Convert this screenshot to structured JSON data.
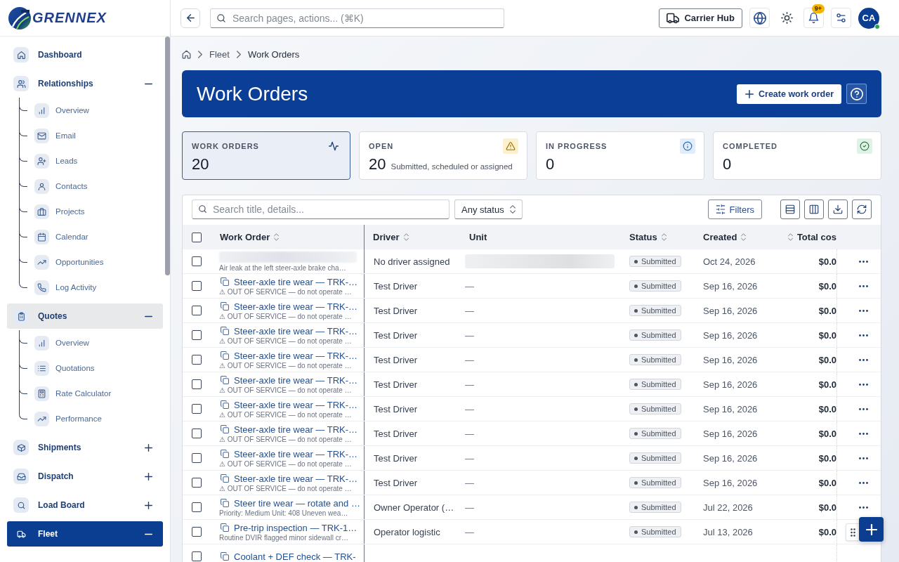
{
  "sidebar": {
    "brand": "GRENNEX",
    "items": [
      {
        "label": "Dashboard",
        "selected": false,
        "highlighted": false
      },
      {
        "label": "Relationships",
        "selected": false,
        "highlighted": false,
        "expanded": true,
        "children": [
          {
            "label": "Overview",
            "selected": false
          },
          {
            "label": "Email",
            "selected": false
          },
          {
            "label": "Leads",
            "selected": false
          },
          {
            "label": "Contacts",
            "selected": false
          },
          {
            "label": "Projects",
            "selected": false
          },
          {
            "label": "Calendar",
            "selected": false
          },
          {
            "label": "Opportunities",
            "selected": false
          },
          {
            "label": "Log Activity",
            "selected": false
          }
        ]
      },
      {
        "label": "Quotes",
        "selected": false,
        "highlighted": true,
        "expanded": true,
        "children": [
          {
            "label": "Overview",
            "selected": false
          },
          {
            "label": "Quotations",
            "selected": false
          },
          {
            "label": "Rate Calculator",
            "selected": false
          },
          {
            "label": "Performance",
            "selected": false
          }
        ]
      },
      {
        "label": "Shipments",
        "selected": false,
        "highlighted": false,
        "expanded": false
      },
      {
        "label": "Dispatch",
        "selected": false,
        "highlighted": false,
        "expanded": false
      },
      {
        "label": "Load Board",
        "selected": false,
        "highlighted": false,
        "expanded": false
      },
      {
        "label": "Fleet",
        "selected": true,
        "highlighted": false,
        "expanded": true
      }
    ]
  },
  "top_bar": {
    "search": {
      "placeholder": "Search pages, actions... (⌘K)"
    },
    "hub_button": "Carrier Hub",
    "notifications": {
      "badge": "9+"
    },
    "avatar": {
      "initials": "CA",
      "online": true
    }
  },
  "breadcrumb": [
    {
      "label": "Fleet",
      "current": false
    },
    {
      "label": "Work Orders",
      "current": true
    }
  ],
  "page_header": {
    "title": "Work Orders",
    "create_button": "Create work order"
  },
  "stats": [
    {
      "kind": "total",
      "label": "WORK ORDERS",
      "value": "20",
      "selected": true
    },
    {
      "kind": "open",
      "label": "OPEN",
      "value": "20",
      "note": "Submitted, scheduled or assigned",
      "selected": false
    },
    {
      "kind": "in_progress",
      "label": "IN PROGRESS",
      "value": "0",
      "selected": false
    },
    {
      "kind": "completed",
      "label": "COMPLETED",
      "value": "0",
      "selected": false
    }
  ],
  "work_orders": {
    "search": {
      "placeholder": "Search title, details..."
    },
    "status_filter": "Any status",
    "filters_button": "Filters",
    "all_selected": false,
    "columns": [
      {
        "kind": "text",
        "label": "Work Order",
        "sortable": true
      },
      {
        "kind": "text",
        "label": "Driver",
        "sortable": true
      },
      {
        "kind": "text",
        "label": "Unit",
        "sortable": false
      },
      {
        "kind": "text",
        "label": "Status",
        "sortable": true
      },
      {
        "kind": "text",
        "label": "Created",
        "sortable": true
      },
      {
        "kind": "money",
        "label": "Total cos",
        "sortable": true
      }
    ],
    "rows": [
      {
        "selected": false,
        "title_blurred": true,
        "details": "Air leak at the left steer-axle brake cha…",
        "driver": "No driver assigned",
        "unit_blurred": true,
        "status": "Submitted",
        "created": "Oct 24, 2026",
        "total": "$0.0",
        "menu_button": true
      },
      {
        "selected": false,
        "title": "Steer-axle tire wear — TRK-…",
        "details": "⚠ OUT OF SERVICE — do not operate …",
        "driver": "Test Driver",
        "unit": "—",
        "status": "Submitted",
        "created": "Sep 16, 2026",
        "total": "$0.0",
        "menu_button": true
      },
      {
        "selected": false,
        "title": "Steer-axle tire wear — TRK-…",
        "details": "⚠ OUT OF SERVICE — do not operate …",
        "driver": "Test Driver",
        "unit": "—",
        "status": "Submitted",
        "created": "Sep 16, 2026",
        "total": "$0.0",
        "menu_button": true
      },
      {
        "selected": false,
        "title": "Steer-axle tire wear — TRK-…",
        "details": "⚠ OUT OF SERVICE — do not operate …",
        "driver": "Test Driver",
        "unit": "—",
        "status": "Submitted",
        "created": "Sep 16, 2026",
        "total": "$0.0",
        "menu_button": true
      },
      {
        "selected": false,
        "title": "Steer-axle tire wear — TRK-…",
        "details": "⚠ OUT OF SERVICE — do not operate …",
        "driver": "Test Driver",
        "unit": "—",
        "status": "Submitted",
        "created": "Sep 16, 2026",
        "total": "$0.0",
        "menu_button": true
      },
      {
        "selected": false,
        "title": "Steer-axle tire wear — TRK-…",
        "details": "⚠ OUT OF SERVICE — do not operate …",
        "driver": "Test Driver",
        "unit": "—",
        "status": "Submitted",
        "created": "Sep 16, 2026",
        "total": "$0.0",
        "menu_button": true
      },
      {
        "selected": false,
        "title": "Steer-axle tire wear — TRK-…",
        "details": "⚠ OUT OF SERVICE — do not operate …",
        "driver": "Test Driver",
        "unit": "—",
        "status": "Submitted",
        "created": "Sep 16, 2026",
        "total": "$0.0",
        "menu_button": true
      },
      {
        "selected": false,
        "title": "Steer-axle tire wear — TRK-…",
        "details": "⚠ OUT OF SERVICE — do not operate …",
        "driver": "Test Driver",
        "unit": "—",
        "status": "Submitted",
        "created": "Sep 16, 2026",
        "total": "$0.0",
        "menu_button": true
      },
      {
        "selected": false,
        "title": "Steer-axle tire wear — TRK-…",
        "details": "⚠ OUT OF SERVICE — do not operate …",
        "driver": "Test Driver",
        "unit": "—",
        "status": "Submitted",
        "created": "Sep 16, 2026",
        "total": "$0.0",
        "menu_button": true
      },
      {
        "selected": false,
        "title": "Steer-axle tire wear — TRK-…",
        "details": "⚠ OUT OF SERVICE — do not operate …",
        "driver": "Test Driver",
        "unit": "—",
        "status": "Submitted",
        "created": "Sep 16, 2026",
        "total": "$0.0",
        "menu_button": true
      },
      {
        "selected": false,
        "title": "Steer tire wear — rotate and …",
        "details": "Priority: Medium Unit: 408 Uneven wea…",
        "driver": "Owner Operator (…",
        "unit": "—",
        "status": "Submitted",
        "created": "Jul 22, 2026",
        "total": "$0.0",
        "menu_button": true
      },
      {
        "selected": false,
        "title": "Pre-trip inspection — TRK-1…",
        "details": "Routine DVIR flagged minor sidewall cr…",
        "driver": "Operator logistic",
        "unit": "—",
        "status": "Submitted",
        "created": "Jul 13, 2026",
        "total": "$0.0",
        "menu_button": false
      },
      {
        "selected": false,
        "title": "Coolant + DEF check — TRK-",
        "menu_button": false
      }
    ]
  }
}
